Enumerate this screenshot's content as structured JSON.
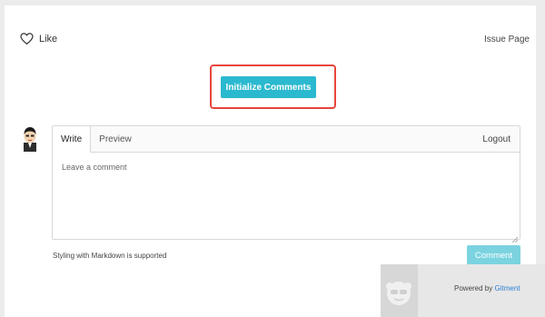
{
  "header": {
    "like_label": "Like",
    "issue_link": "Issue Page"
  },
  "actions": {
    "initialize_label": "Initialize Comments"
  },
  "editor": {
    "tabs": [
      {
        "label": "Write",
        "active": true
      },
      {
        "label": "Preview",
        "active": false
      }
    ],
    "logout_label": "Logout",
    "placeholder": "Leave a comment",
    "markdown_note": "Styling with Markdown is supported",
    "submit_label": "Comment"
  },
  "footer": {
    "powered_prefix": "Powered by",
    "powered_link": "Gitment"
  },
  "colors": {
    "accent": "#2bb9cf",
    "accent_disabled": "#7bd3e0",
    "highlight": "#e8453c",
    "link": "#2b80d4"
  }
}
